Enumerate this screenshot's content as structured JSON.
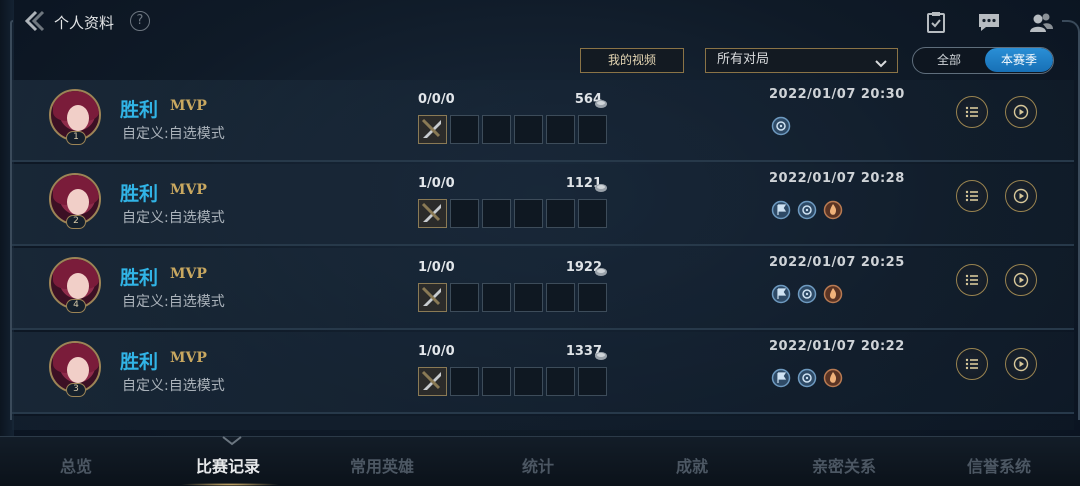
{
  "header": {
    "title": "个人资料",
    "help_label": "?"
  },
  "top_icons": [
    "task-icon",
    "chat-icon",
    "friends-icon"
  ],
  "toolbar": {
    "video_button": "我的视频",
    "match_filter": {
      "selected": "所有对局"
    },
    "season_toggle": {
      "all": "全部",
      "season": "本赛季",
      "selected": "本赛季"
    }
  },
  "matches": [
    {
      "result": "胜利",
      "mvp": "MVP",
      "mode": "自定义:自选模式",
      "kda": "0/0/0",
      "score": "564",
      "date": "2022/01/07 20:30",
      "badge": "1",
      "medals": [
        "blue-target-medal"
      ]
    },
    {
      "result": "胜利",
      "mvp": "MVP",
      "mode": "自定义:自选模式",
      "kda": "1/0/0",
      "score": "1121",
      "date": "2022/01/07 20:28",
      "badge": "2",
      "medals": [
        "blue-flag-medal",
        "blue-target-medal",
        "bronze-flame-medal"
      ]
    },
    {
      "result": "胜利",
      "mvp": "MVP",
      "mode": "自定义:自选模式",
      "kda": "1/0/0",
      "score": "1922",
      "date": "2022/01/07 20:25",
      "badge": "4",
      "medals": [
        "blue-flag-medal",
        "blue-target-medal",
        "bronze-flame-medal"
      ]
    },
    {
      "result": "胜利",
      "mvp": "MVP",
      "mode": "自定义:自选模式",
      "kda": "1/0/0",
      "score": "1337",
      "date": "2022/01/07 20:22",
      "badge": "3",
      "medals": [
        "blue-flag-medal",
        "blue-target-medal",
        "bronze-flame-medal"
      ]
    }
  ],
  "bottom_nav": {
    "items": [
      "总览",
      "比赛记录",
      "常用英雄",
      "统计",
      "成就",
      "亲密关系",
      "信誉系统"
    ],
    "active": "比赛记录"
  },
  "colors": {
    "win": "#31b4e6",
    "mvp": "#c9a860",
    "gold_border": "#8a7346",
    "season_active": "#1f80c6"
  }
}
